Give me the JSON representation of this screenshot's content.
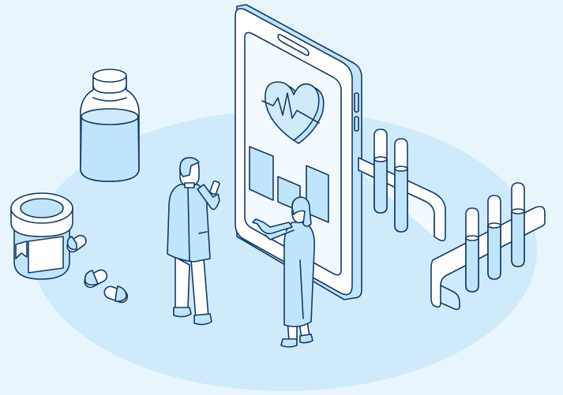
{
  "scene": {
    "description_free": true,
    "palette": {
      "background": "#e9f5fd",
      "floor": "#cfeafb",
      "line": "#153a66",
      "fill_light": "#f3faff",
      "fill_mid": "#bfe4fb",
      "fill_white": "#ffffff"
    },
    "icons": [
      "smartphone-icon",
      "heart-pulse-icon",
      "bar-chart-icon",
      "medicine-bottle-icon",
      "pill-jar-icon",
      "capsule-icon",
      "test-tube-rack-icon",
      "doctor-figure",
      "patient-figure"
    ]
  }
}
